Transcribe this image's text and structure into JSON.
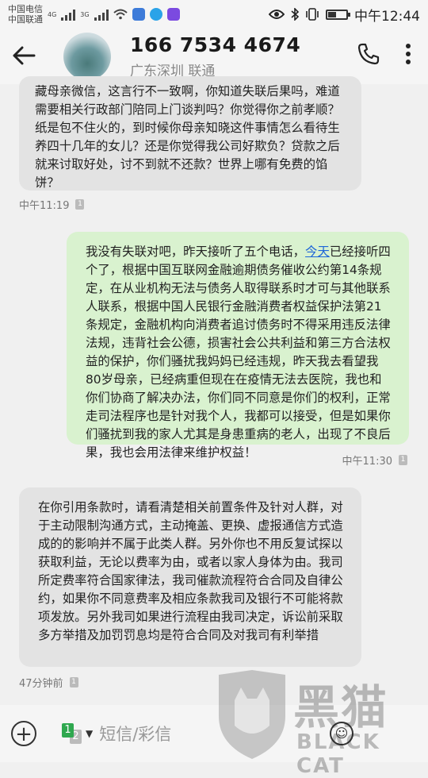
{
  "status_bar": {
    "carrier_1": "中国电信",
    "carrier_2": "中国联通",
    "net_1": "4G",
    "net_2": "3G",
    "time": "中午12:44"
  },
  "header": {
    "phone_number": "166 7534 4674",
    "location": "广东深圳 联通"
  },
  "messages": [
    {
      "direction": "incoming",
      "text": "藏母亲微信，这言行不一致啊，你知道失联后果吗，难道需要相关行政部门陪同上门谈判吗？你觉得你之前孝顺？纸是包不住火的，到时候你母亲知晓这件事情怎么看待生养四十几年的女儿？还是你觉得我公司好欺负？贷款之后就来讨取好处，讨不到就不还款？世界上哪有免费的馅饼？",
      "time": "中午11:19",
      "sim": "1"
    },
    {
      "direction": "outgoing",
      "text_before_link": "我没有失联对吧，昨天接听了五个电话，",
      "link_text": "今天",
      "text_after_link": "已经接听四个了，根据中国互联网金融逾期债务催收公约第14条规定，在从业机构无法与债务人取得联系时才可与其他联系人联系，根据中国人民银行金融消费者权益保护法第21条规定，金融机构向消费者追讨债务时不得采用违反法律法规，违背社会公德，损害社会公共利益和第三方合法权益的保护，你们骚扰我妈妈已经违规，昨天我去看望我80岁母亲，已经病重但现在在疫情无法去医院，我也和你们协商了解决办法，你们同不同意是你们的权利，正常走司法程序也是针对我个人，我都可以接受，但是如果你们骚扰到我的家人尤其是身患重病的老人，出现了不良后果，我也会用法律来维护权益！",
      "time": "中午11:30",
      "sim": "1"
    },
    {
      "direction": "incoming",
      "text": "在你引用条款时，请看清楚相关前置条件及针对人群，对于主动限制沟通方式，主动掩盖、更换、虚报通信方式造成的的影响并不属于此类人群。另外你也不用反复试探以获取利益，无论以费率为由，或者以家人身体为由。我司所定费率符合国家律法，我司催款流程符合合同及自律公约，如果你不同意费率及相应条款我司及银行不可能将款项发放。另外我司如果进行流程由我司决定，诉讼前采取多方举措及加罚罚息均是符合合同及对我司有利举措",
      "time": "47分钟前",
      "sim": "1"
    }
  ],
  "input": {
    "placeholder": "短信/彩信",
    "sim_primary": "1",
    "sim_secondary": "2"
  },
  "watermark": {
    "chinese": "黑猫",
    "english": "BLACK CAT"
  }
}
